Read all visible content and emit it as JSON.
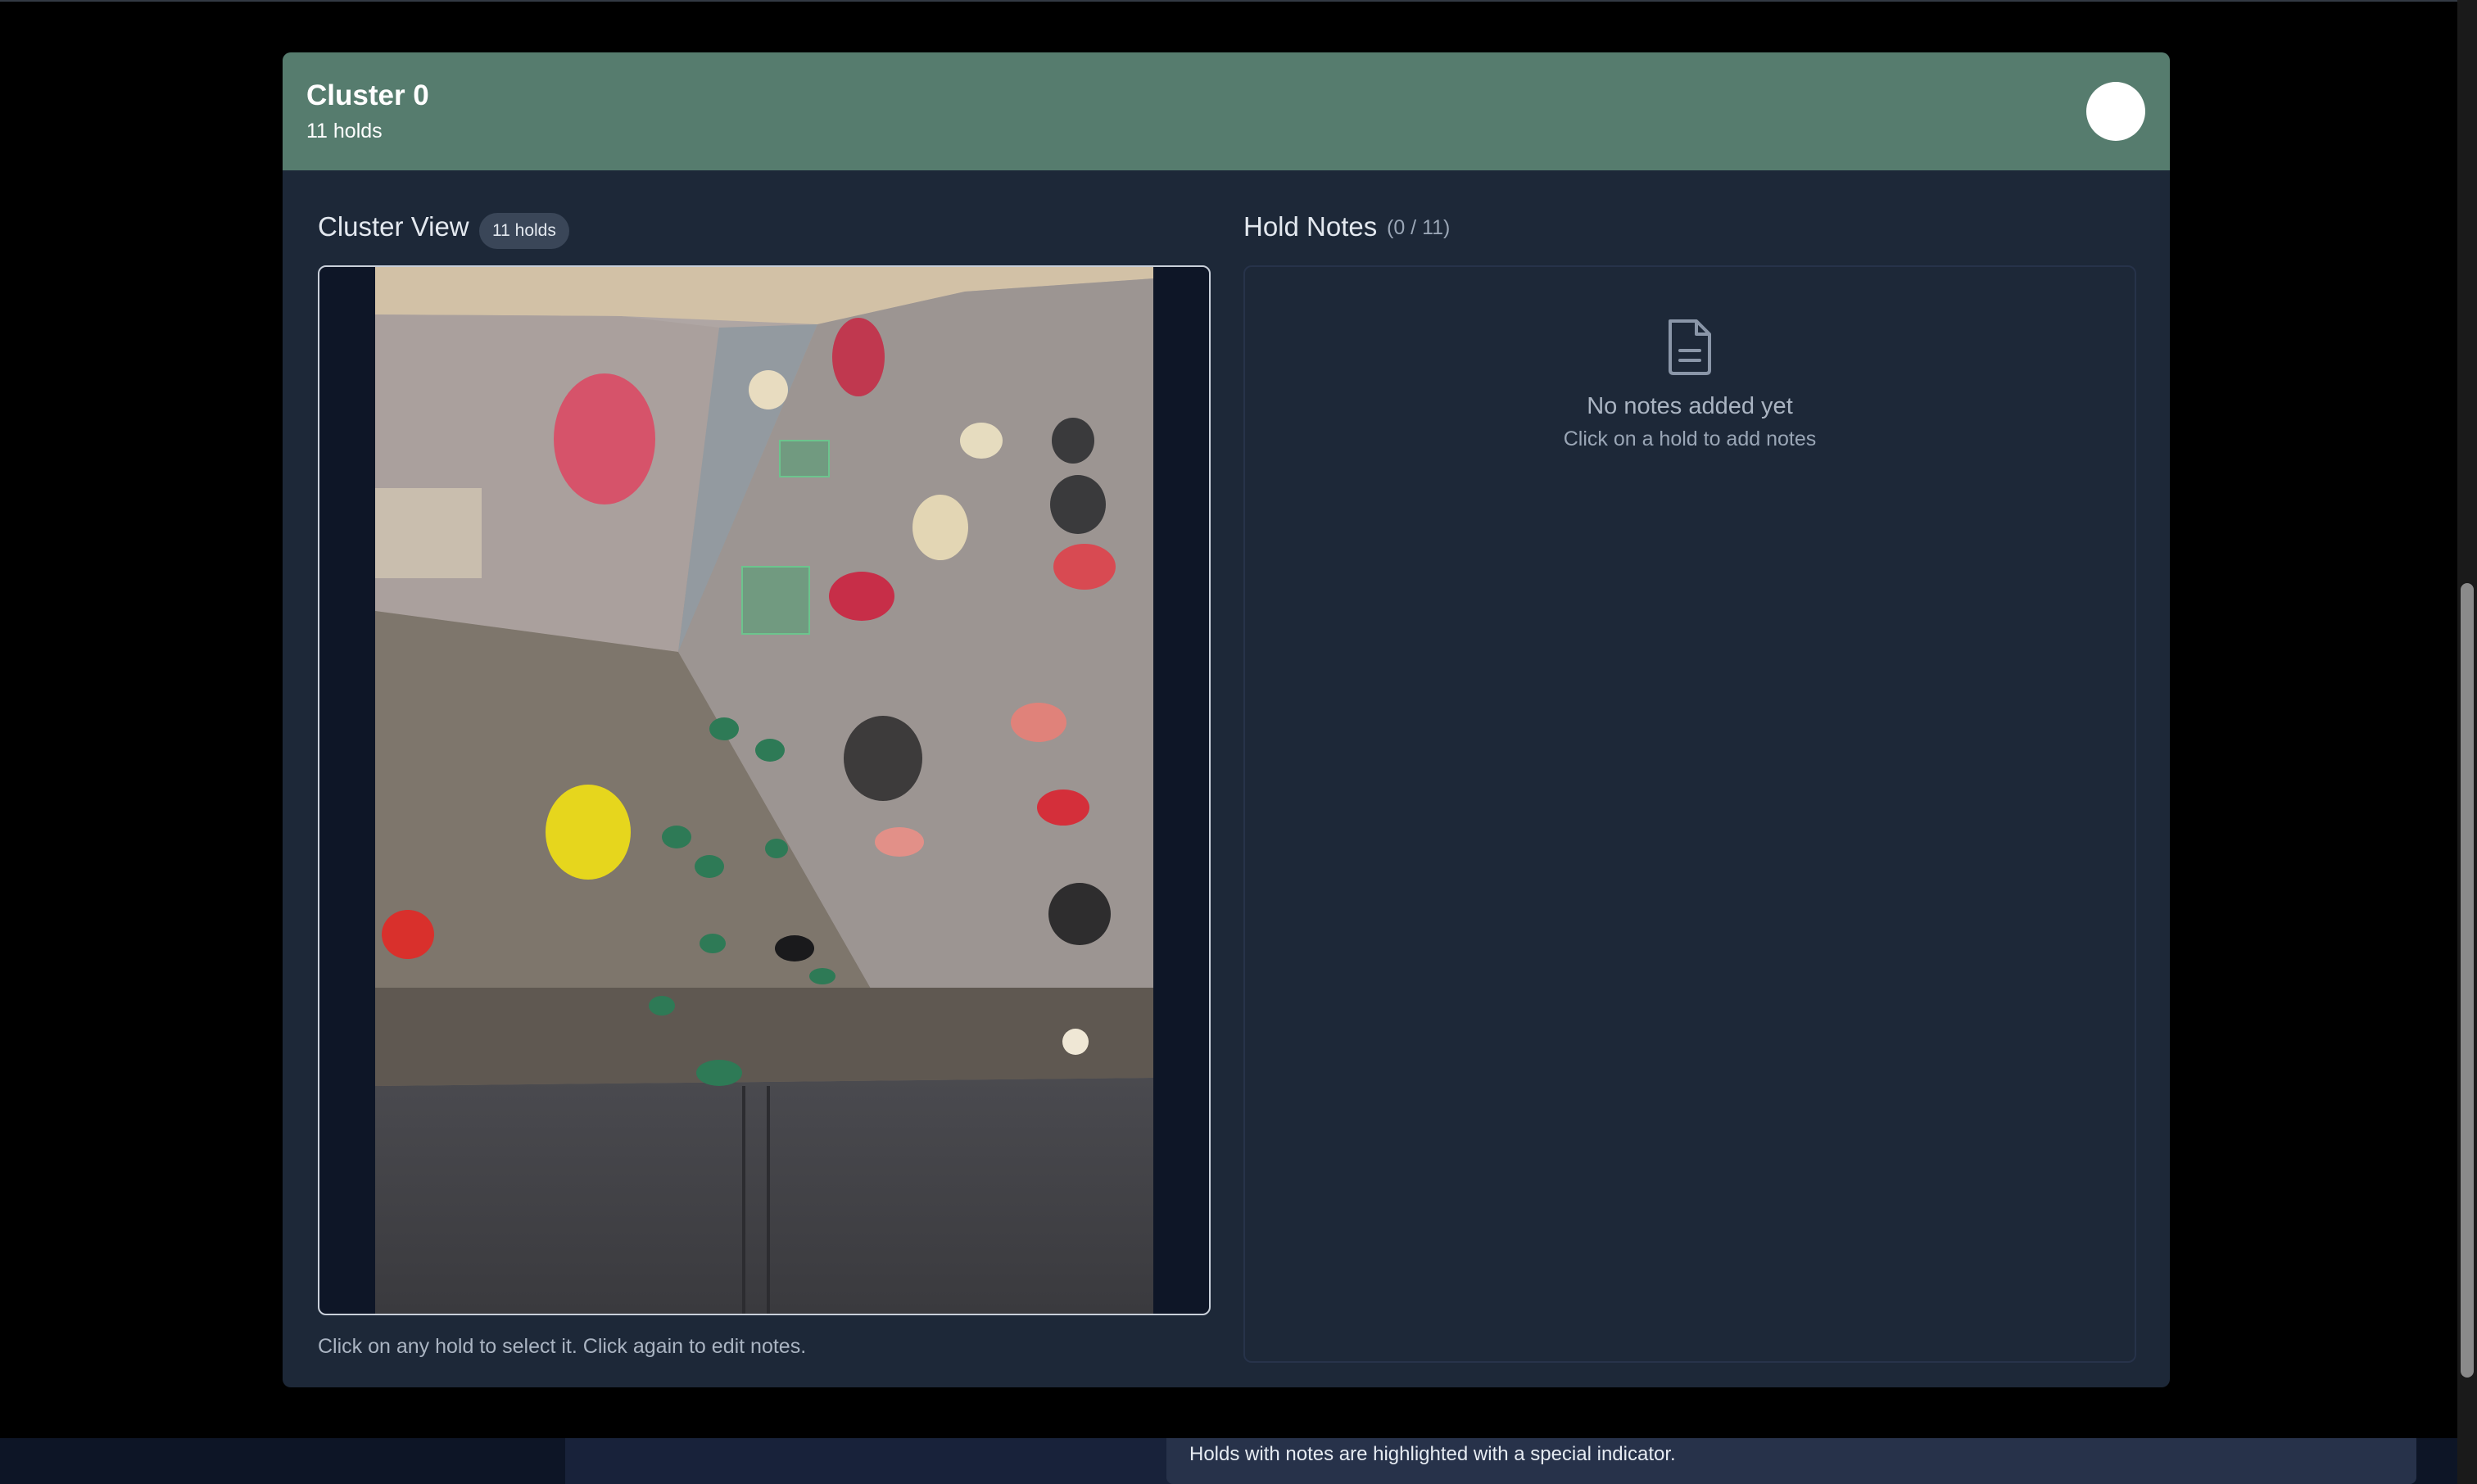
{
  "modal": {
    "title": "Cluster 0",
    "subtitle": "11 holds",
    "close_icon": "close-icon"
  },
  "cluster_view": {
    "title": "Cluster View",
    "badge": "11 holds",
    "hint": "Click on any hold to select it. Click again to edit notes."
  },
  "hold_notes": {
    "title": "Hold Notes",
    "count": "(0 / 11)",
    "empty_icon": "document-icon",
    "empty_title": "No notes added yet",
    "empty_subtitle": "Click on a hold to add notes"
  },
  "background_page": {
    "info_text": "Holds with notes are highlighted with a special indicator."
  },
  "colors": {
    "header": "#567c6e",
    "panel": "#1d2838",
    "selection": "#3fa06a"
  }
}
